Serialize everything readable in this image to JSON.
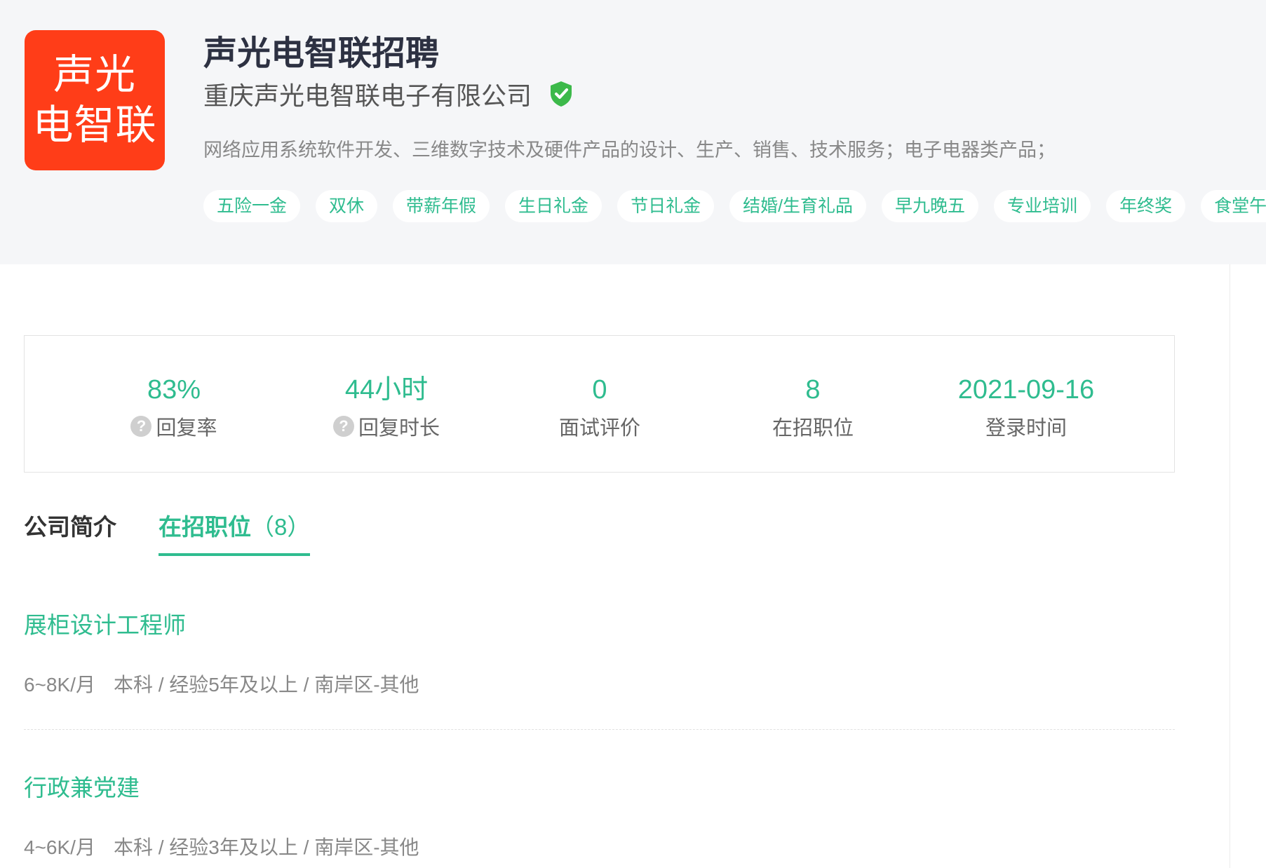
{
  "company": {
    "logo_lines": [
      "声光",
      "电智联"
    ],
    "title": "声光电智联招聘",
    "full_name": "重庆声光电智联电子有限公司",
    "verified_icon": "shield-check-icon",
    "description": "网络应用系统软件开发、三维数字技术及硬件产品的设计、生产、销售、技术服务；电子电器类产品；",
    "tags": [
      "五险一金",
      "双休",
      "带薪年假",
      "生日礼金",
      "节日礼金",
      "结婚/生育礼品",
      "早九晚五",
      "专业培训",
      "年终奖",
      "食堂午餐"
    ]
  },
  "stats": [
    {
      "value": "83%",
      "label": "回复率",
      "has_help": true
    },
    {
      "value": "44小时",
      "label": "回复时长",
      "has_help": true
    },
    {
      "value": "0",
      "label": "面试评价",
      "has_help": false
    },
    {
      "value": "8",
      "label": "在招职位",
      "has_help": false
    },
    {
      "value": "2021-09-16",
      "label": "登录时间",
      "has_help": false
    }
  ],
  "help_glyph": "?",
  "tabs": {
    "intro": "公司简介",
    "jobs": "在招职位",
    "jobs_count": "（8）"
  },
  "jobs": [
    {
      "title": "展柜设计工程师",
      "salary": "6~8K/月",
      "details": "本科 / 经验5年及以上 / 南岸区-其他"
    },
    {
      "title": "行政兼党建",
      "salary": "4~6K/月",
      "details": "本科 / 经验3年及以上 / 南岸区-其他"
    }
  ],
  "colors": {
    "accent": "#2fbc8f",
    "logo_bg": "#ff3d18",
    "header_bg": "#f5f6f8",
    "verified": "#3cb94a"
  }
}
